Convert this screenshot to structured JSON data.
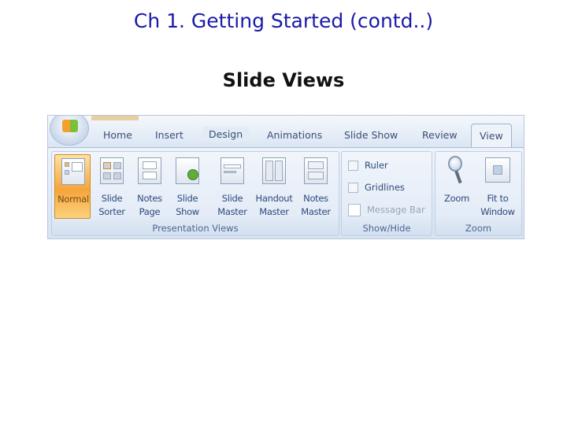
{
  "slide": {
    "title": "Ch 1. Getting Started (contd..)",
    "subtitle": "Slide Views"
  },
  "ribbon": {
    "tabs": [
      {
        "label": "Home",
        "active": false
      },
      {
        "label": "Insert",
        "active": false
      },
      {
        "label": "Design",
        "active": false
      },
      {
        "label": "Animations",
        "active": false
      },
      {
        "label": "Slide Show",
        "active": false
      },
      {
        "label": "Review",
        "active": false
      },
      {
        "label": "View",
        "active": true
      }
    ],
    "groups": {
      "presentation_views": {
        "label": "Presentation Views",
        "buttons": [
          {
            "label": "Normal",
            "icon": "normal-view-icon",
            "active": true
          },
          {
            "label": "Slide\nSorter",
            "icon": "slide-sorter-icon",
            "active": false
          },
          {
            "label": "Notes\nPage",
            "icon": "notes-page-icon",
            "active": false
          },
          {
            "label": "Slide\nShow",
            "icon": "slide-show-icon",
            "active": false
          },
          {
            "label": "Slide\nMaster",
            "icon": "slide-master-icon",
            "active": false
          },
          {
            "label": "Handout\nMaster",
            "icon": "handout-master-icon",
            "active": false
          },
          {
            "label": "Notes\nMaster",
            "icon": "notes-master-icon",
            "active": false
          }
        ]
      },
      "show_hide": {
        "label": "Show/Hide",
        "checkboxes": [
          {
            "label": "Ruler",
            "checked": false,
            "enabled": true
          },
          {
            "label": "Gridlines",
            "checked": false,
            "enabled": true
          },
          {
            "label": "Message Bar",
            "checked": false,
            "enabled": false
          }
        ]
      },
      "zoom": {
        "label": "Zoom",
        "buttons": [
          {
            "label": "Zoom",
            "icon": "magnifier-icon"
          },
          {
            "label": "Fit to\nWindow",
            "icon": "fit-to-window-icon"
          }
        ]
      }
    }
  }
}
